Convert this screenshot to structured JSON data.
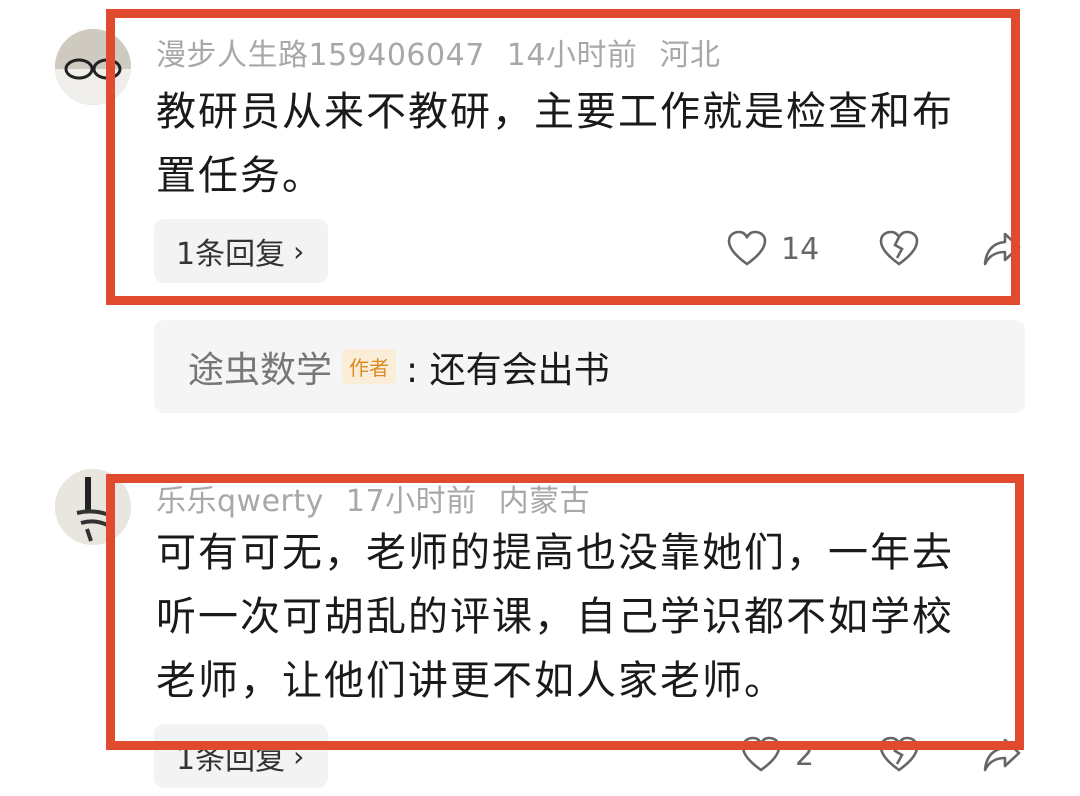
{
  "comments": [
    {
      "username": "漫步人生路159406047",
      "time": "14小时前",
      "location": "河北",
      "line1": "教研员从来不教研，主要工作就是检查和布",
      "line2": "置任务。",
      "replies_label": "1条回复",
      "likes": "14"
    },
    {
      "username": "乐乐qwerty",
      "time": "17小时前",
      "location": "内蒙古",
      "line1": "可有可无，老师的提高也没靠她们，一年去",
      "line2": "听一次可胡乱的评课，自己学识都不如学校",
      "line3": "老师，让他们讲更不如人家老师。",
      "replies_label": "1条回复",
      "likes": "2"
    }
  ],
  "quoted_reply": {
    "author": "途虫数学",
    "author_badge": "作者",
    "text": ": 还有会出书"
  },
  "colors": {
    "highlight": "#e04a2e",
    "meta": "#a8a8a8",
    "badge": "#d98a23"
  },
  "icons": [
    "heart-icon",
    "dislike-heart-icon",
    "share-icon",
    "chevron-right-icon"
  ]
}
